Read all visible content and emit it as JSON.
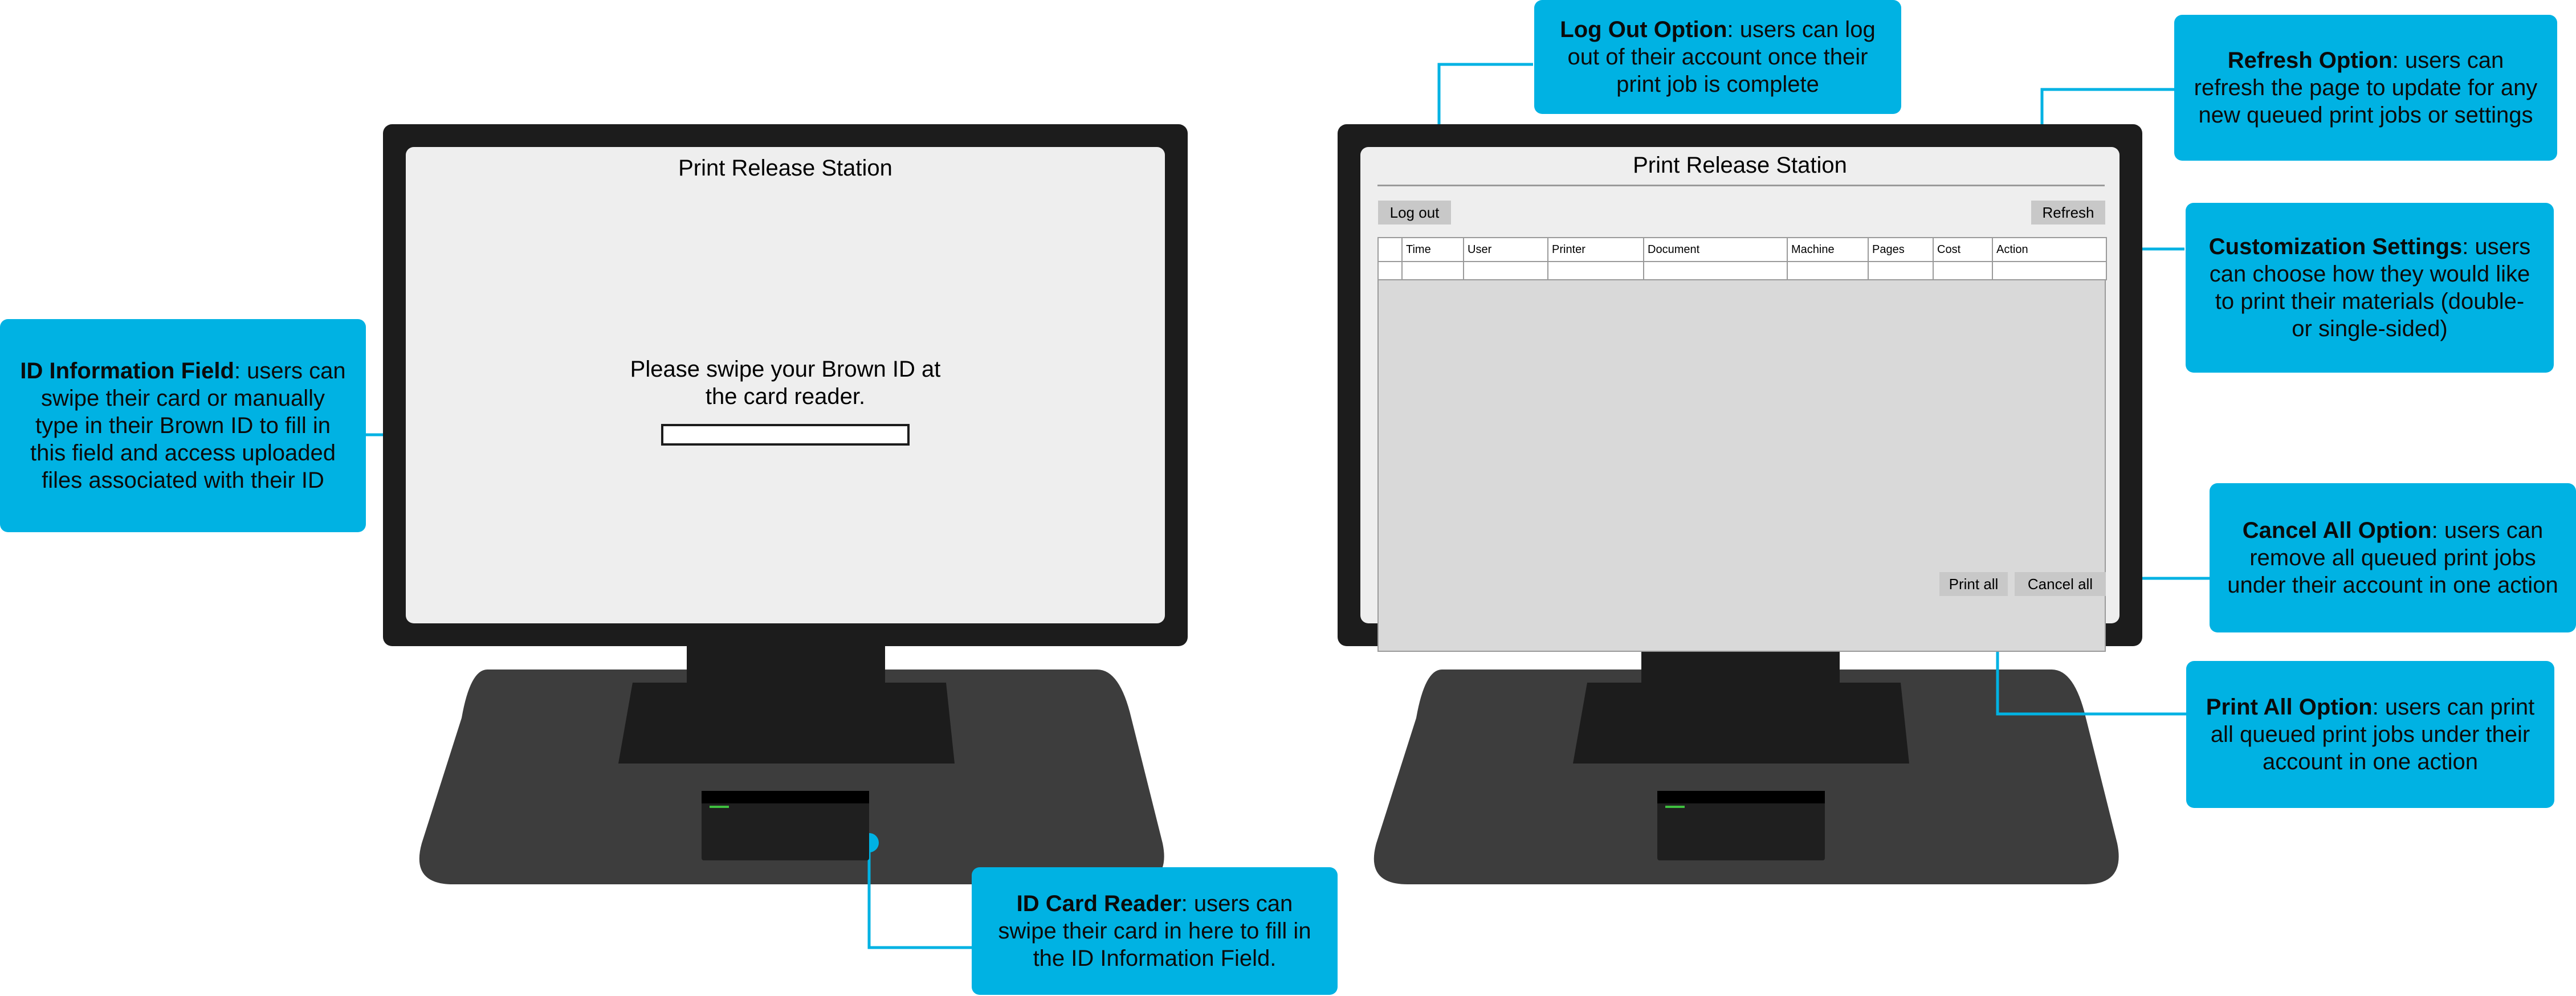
{
  "left_screen": {
    "title": "Print Release Station",
    "prompt": "Please swipe your Brown ID at the card reader."
  },
  "right_screen": {
    "title": "Print Release Station",
    "logout_label": "Log out",
    "refresh_label": "Refresh",
    "table_columns": [
      "",
      "Time",
      "User",
      "Printer",
      "Document",
      "Machine",
      "Pages",
      "Cost",
      "Action"
    ],
    "print_all_label": "Print all",
    "cancel_all_label": "Cancel all"
  },
  "callouts": {
    "id_field": {
      "title": "ID Information Field",
      "text": ": users can swipe their card or manually type in their Brown ID to fill in this field and access uploaded files associated with their ID"
    },
    "card_reader": {
      "title": "ID Card Reader",
      "text": ": users can swipe their card in here to fill in the ID Information Field."
    },
    "logout": {
      "title": "Log Out Option",
      "text": ": users can log out of their account once their print job is complete"
    },
    "refresh": {
      "title": "Refresh Option",
      "text": ": users can refresh the page to update for any new queued print jobs or settings"
    },
    "customization": {
      "title": "Customization Settings",
      "text": ": users can choose how they would like to print their materials (double- or single-sided)"
    },
    "cancel_all": {
      "title": "Cancel All Option",
      "text": ": users can remove all queued print jobs under their account in one action"
    },
    "print_all": {
      "title": "Print All Option",
      "text": ": users can print all queued print jobs under their account in one action"
    }
  },
  "colors": {
    "callout": "#00b2e3",
    "bezel": "#1c1c1c",
    "screen": "#eeeeee",
    "platform": "#3d3d3d"
  }
}
